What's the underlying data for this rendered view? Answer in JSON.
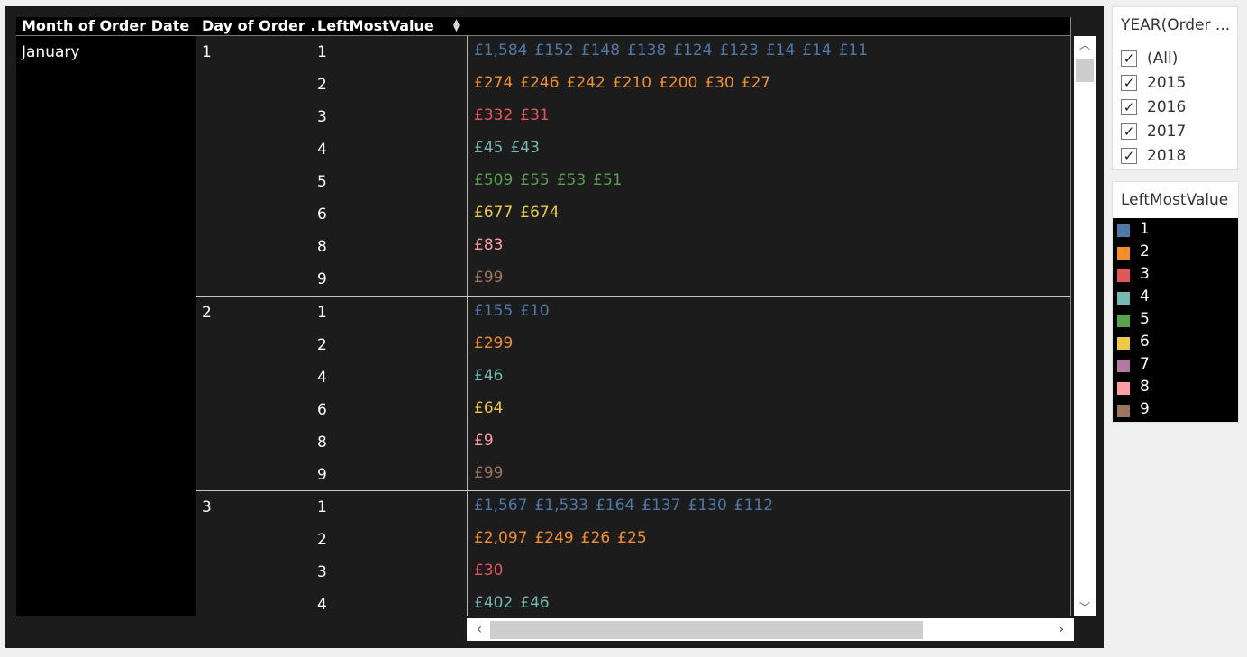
{
  "headers": {
    "month": "Month of Order Date",
    "day": "Day of Order ..",
    "leftmost": "LeftMostValue"
  },
  "colors": {
    "1": "#4e79a7",
    "2": "#f28e2b",
    "3": "#e15759",
    "4": "#76b7b2",
    "5": "#59a14f",
    "6": "#edc948",
    "7": "#b07aa1",
    "8": "#ff9da7",
    "9": "#9c755f"
  },
  "table": {
    "month": "January",
    "days": [
      {
        "day": "1",
        "rows": [
          {
            "lm": "1",
            "values": [
              "£1,584",
              "£152",
              "£148",
              "£138",
              "£124",
              "£123",
              "£14",
              "£14",
              "£11"
            ]
          },
          {
            "lm": "2",
            "values": [
              "£274",
              "£246",
              "£242",
              "£210",
              "£200",
              "£30",
              "£27"
            ]
          },
          {
            "lm": "3",
            "values": [
              "£332",
              "£31"
            ]
          },
          {
            "lm": "4",
            "values": [
              "£45",
              "£43"
            ]
          },
          {
            "lm": "5",
            "values": [
              "£509",
              "£55",
              "£53",
              "£51"
            ]
          },
          {
            "lm": "6",
            "values": [
              "£677",
              "£674"
            ]
          },
          {
            "lm": "8",
            "values": [
              "£83"
            ]
          },
          {
            "lm": "9",
            "values": [
              "£99"
            ]
          }
        ]
      },
      {
        "day": "2",
        "rows": [
          {
            "lm": "1",
            "values": [
              "£155",
              "£10"
            ]
          },
          {
            "lm": "2",
            "values": [
              "£299"
            ]
          },
          {
            "lm": "4",
            "values": [
              "£46"
            ]
          },
          {
            "lm": "6",
            "values": [
              "£64"
            ]
          },
          {
            "lm": "8",
            "values": [
              "£9"
            ]
          },
          {
            "lm": "9",
            "values": [
              "£99"
            ]
          }
        ]
      },
      {
        "day": "3",
        "rows": [
          {
            "lm": "1",
            "values": [
              "£1,567",
              "£1,533",
              "£164",
              "£137",
              "£130",
              "£112"
            ]
          },
          {
            "lm": "2",
            "values": [
              "£2,097",
              "£249",
              "£26",
              "£25"
            ]
          },
          {
            "lm": "3",
            "values": [
              "£30"
            ]
          },
          {
            "lm": "4",
            "values": [
              "£402",
              "£46"
            ]
          }
        ]
      }
    ]
  },
  "year_filter": {
    "title": "YEAR(Order ...",
    "items": [
      {
        "label": "(All)",
        "checked": true
      },
      {
        "label": "2015",
        "checked": true
      },
      {
        "label": "2016",
        "checked": true
      },
      {
        "label": "2017",
        "checked": true
      },
      {
        "label": "2018",
        "checked": true
      }
    ]
  },
  "legend": {
    "title": "LeftMostValue",
    "items": [
      {
        "label": "1",
        "color": "#4e79a7"
      },
      {
        "label": "2",
        "color": "#f28e2b"
      },
      {
        "label": "3",
        "color": "#e15759"
      },
      {
        "label": "4",
        "color": "#76b7b2"
      },
      {
        "label": "5",
        "color": "#59a14f"
      },
      {
        "label": "6",
        "color": "#edc948"
      },
      {
        "label": "7",
        "color": "#b07aa1"
      },
      {
        "label": "8",
        "color": "#ff9da7"
      },
      {
        "label": "9",
        "color": "#9c755f"
      }
    ]
  },
  "icons": {
    "sort": "sort-icon",
    "scroll_up": "chevron-up-icon",
    "scroll_down": "chevron-down-icon",
    "scroll_left": "chevron-left-icon",
    "scroll_right": "chevron-right-icon",
    "check": "checkmark-icon"
  }
}
